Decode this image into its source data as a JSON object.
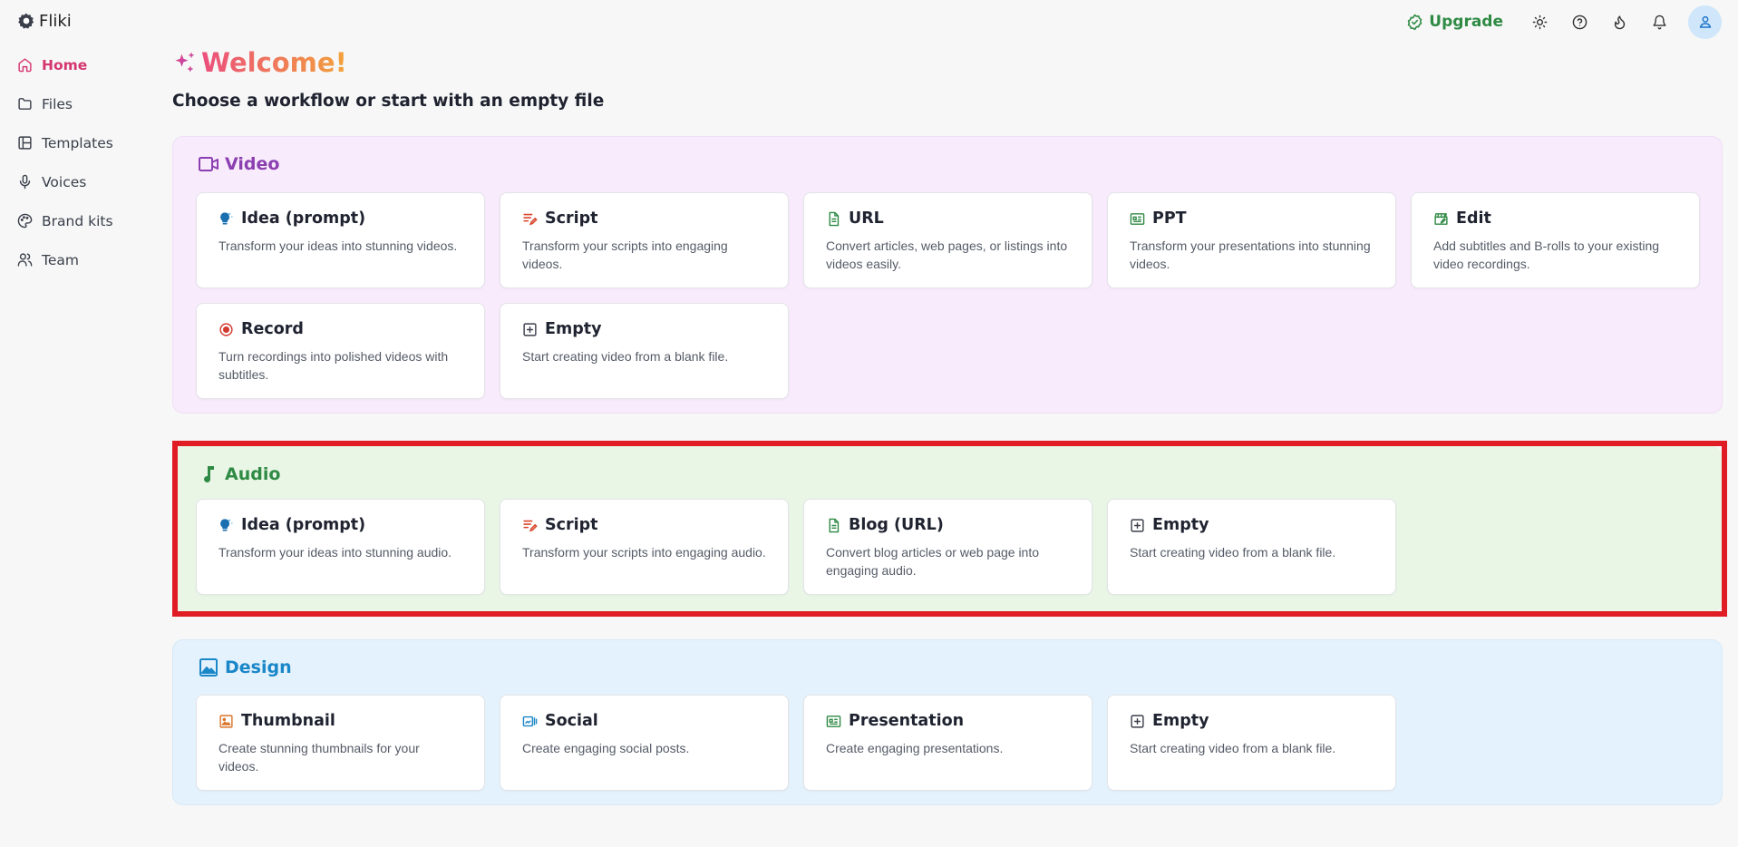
{
  "app": {
    "name": "Fliki"
  },
  "topbar": {
    "upgrade_label": "Upgrade",
    "icons": [
      "sun-icon",
      "help-icon",
      "flame-icon",
      "bell-icon",
      "user-icon"
    ]
  },
  "sidebar": {
    "items": [
      {
        "label": "Home",
        "icon": "home-icon",
        "active": true
      },
      {
        "label": "Files",
        "icon": "folder-icon"
      },
      {
        "label": "Templates",
        "icon": "layout-icon"
      },
      {
        "label": "Voices",
        "icon": "mic-icon"
      },
      {
        "label": "Brand kits",
        "icon": "palette-icon"
      },
      {
        "label": "Team",
        "icon": "users-icon"
      }
    ]
  },
  "main": {
    "welcome": "Welcome!",
    "subtitle": "Choose a workflow or start with an empty file",
    "sections": {
      "video": {
        "title": "Video",
        "cards": [
          {
            "title": "Idea (prompt)",
            "desc": "Transform your ideas into stunning videos."
          },
          {
            "title": "Script",
            "desc": "Transform your scripts into engaging videos."
          },
          {
            "title": "URL",
            "desc": "Convert articles, web pages, or listings into videos easily."
          },
          {
            "title": "PPT",
            "desc": "Transform your presentations into stunning videos."
          },
          {
            "title": "Edit",
            "desc": "Add subtitles and B-rolls to your existing video recordings."
          },
          {
            "title": "Record",
            "desc": "Turn recordings into polished videos with subtitles."
          },
          {
            "title": "Empty",
            "desc": "Start creating video from a blank file."
          }
        ]
      },
      "audio": {
        "title": "Audio",
        "cards": [
          {
            "title": "Idea (prompt)",
            "desc": "Transform your ideas into stunning audio."
          },
          {
            "title": "Script",
            "desc": "Transform your scripts into engaging audio."
          },
          {
            "title": "Blog (URL)",
            "desc": "Convert blog articles or web page into engaging audio."
          },
          {
            "title": "Empty",
            "desc": "Start creating video from a blank file."
          }
        ]
      },
      "design": {
        "title": "Design",
        "cards": [
          {
            "title": "Thumbnail",
            "desc": "Create stunning thumbnails for your videos."
          },
          {
            "title": "Social",
            "desc": "Create engaging social posts."
          },
          {
            "title": "Presentation",
            "desc": "Create engaging presentations."
          },
          {
            "title": "Empty",
            "desc": "Start creating video from a blank file."
          }
        ]
      }
    }
  },
  "colors": {
    "accent_home": "#d6356f",
    "upgrade": "#2f8a44",
    "video": "#8b3fb0",
    "audio": "#2f8a44",
    "design": "#1a87c8",
    "highlight_outline": "#e01d24"
  }
}
